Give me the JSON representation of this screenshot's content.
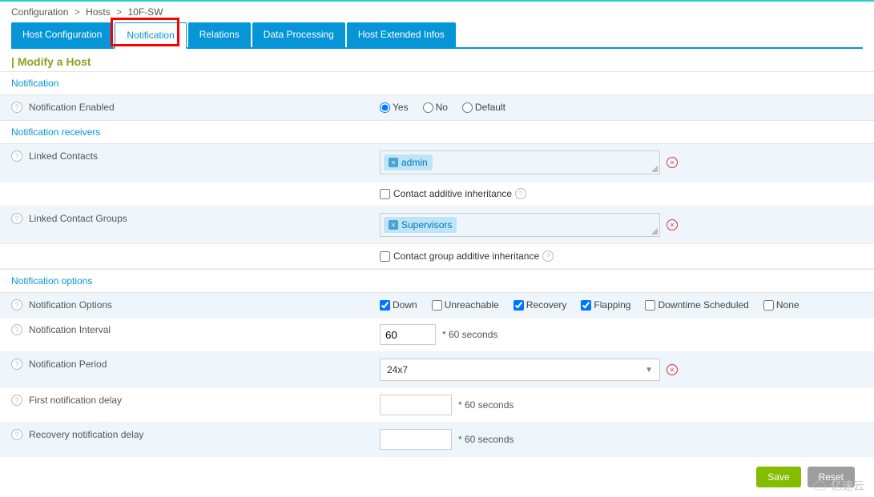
{
  "breadcrumb": {
    "a": "Configuration",
    "b": "Hosts",
    "c": "10F-SW"
  },
  "tabs": {
    "host_config": "Host Configuration",
    "notification": "Notification",
    "relations": "Relations",
    "data_processing": "Data Processing",
    "host_ext": "Host Extended Infos"
  },
  "title_prefix": "|",
  "title": "Modify a Host",
  "groups": {
    "notification": "Notification",
    "receivers": "Notification receivers",
    "options": "Notification options"
  },
  "labels": {
    "enabled": "Notification Enabled",
    "linked_contacts": "Linked Contacts",
    "contact_additive": "Contact additive inheritance",
    "linked_groups": "Linked Contact Groups",
    "group_additive": "Contact group additive inheritance",
    "notif_options": "Notification Options",
    "interval": "Notification Interval",
    "period": "Notification Period",
    "first_delay": "First notification delay",
    "recovery_delay": "Recovery notification delay",
    "suffix_sec": "* 60 seconds"
  },
  "radio": {
    "yes": "Yes",
    "no": "No",
    "default": "Default"
  },
  "tags": {
    "admin": "admin",
    "supervisors": "Supervisors"
  },
  "checkboxes": {
    "down": "Down",
    "unreachable": "Unreachable",
    "recovery": "Recovery",
    "flapping": "Flapping",
    "downtime": "Downtime Scheduled",
    "none": "None"
  },
  "values": {
    "interval": "60",
    "period": "24x7",
    "first_delay": "",
    "recovery_delay": ""
  },
  "buttons": {
    "save": "Save",
    "reset": "Reset"
  },
  "watermark": "亿速云"
}
